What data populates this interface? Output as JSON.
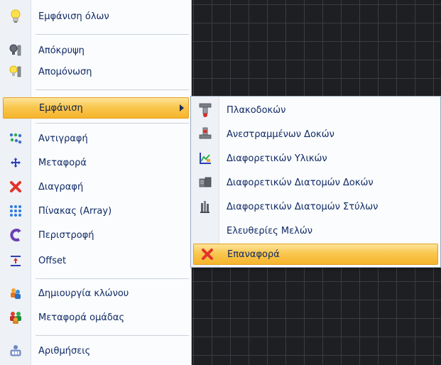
{
  "menu": {
    "items": [
      {
        "label": "Εμφάνιση όλων",
        "icon": "lightbulb-on-icon"
      },
      {
        "label": "Απόκρυψη",
        "icon": "hide-icon"
      },
      {
        "label": "Απομόνωση",
        "icon": "isolate-icon"
      },
      {
        "label": "Εμφάνιση",
        "icon": "",
        "has_submenu": true,
        "highlighted": true
      },
      {
        "label": "Αντιγραφή",
        "icon": "copy-icon"
      },
      {
        "label": "Μεταφορά",
        "icon": "move-icon"
      },
      {
        "label": "Διαγραφή",
        "icon": "delete-icon"
      },
      {
        "label": "Πίνακας (Array)",
        "icon": "array-icon"
      },
      {
        "label": "Περιστροφή",
        "icon": "rotate-icon"
      },
      {
        "label": "Offset",
        "icon": "offset-icon"
      },
      {
        "label": "Δημιουργία κλώνου",
        "icon": "clone-icon"
      },
      {
        "label": "Μεταφορά ομάδας",
        "icon": "group-move-icon"
      },
      {
        "label": "Αριθμήσεις",
        "icon": "numbering-icon"
      }
    ]
  },
  "submenu": {
    "items": [
      {
        "label": "Πλακοδοκών",
        "icon": "t-beam-icon"
      },
      {
        "label": "Ανεστραμμένων Δοκών",
        "icon": "inverted-beam-icon"
      },
      {
        "label": "Διαφορετικών Υλικών",
        "icon": "materials-icon"
      },
      {
        "label": "Διαφορετικών Διατομών Δοκών",
        "icon": "beam-sections-icon"
      },
      {
        "label": "Διαφορετικών Διατομών Στύλων",
        "icon": "column-sections-icon"
      },
      {
        "label": "Ελευθερίες Μελών",
        "icon": ""
      },
      {
        "label": "Επαναφορά",
        "icon": "reset-icon",
        "highlighted": true
      }
    ]
  },
  "colors": {
    "highlight": "#f9c74f",
    "text": "#0f2a66",
    "canvas": "#1e1f22",
    "grid": "#3a3c41"
  }
}
